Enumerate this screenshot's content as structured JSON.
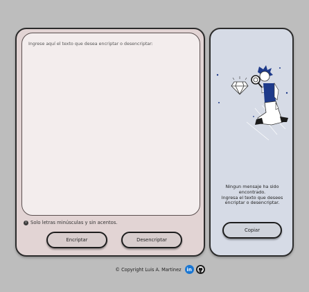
{
  "input": {
    "placeholder": "Ingrese aquí el texto que desea encriptar o desencriptar:"
  },
  "hint": {
    "icon": "info-icon",
    "text": "Solo letras minúsculas y sin acentos."
  },
  "buttons": {
    "encrypt_label": "Encriptar",
    "decrypt_label": "Desencriptar",
    "copy_label": "Copiar"
  },
  "output": {
    "title": "Ningun mensaje ha sido encontrado.",
    "subtitle": "Ingresa el texto que desees encriptar o desencriptar."
  },
  "footer": {
    "copyright": "© Copyright Luis A. Martinez",
    "links": [
      {
        "icon": "linkedin-icon",
        "glyph": "in"
      },
      {
        "icon": "github-icon"
      }
    ]
  },
  "colors": {
    "page_bg": "#bdbdbd",
    "left_panel": "#e2d4d4",
    "text_area": "#f3eded",
    "right_panel": "#d6dbe6",
    "illustration_blue": "#1e3a8a",
    "linkedin": "#1976d2"
  }
}
